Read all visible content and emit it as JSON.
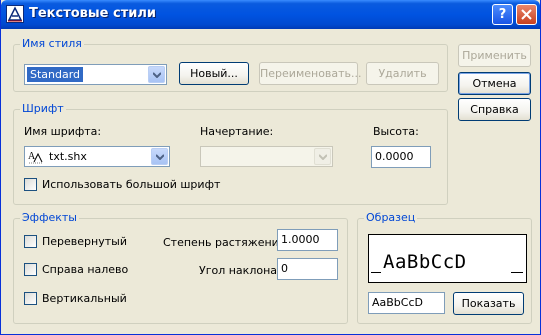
{
  "window": {
    "title": "Текстовые стили",
    "help_glyph": "?"
  },
  "style_group": {
    "legend": "Имя стиля",
    "style_combo_value": "Standard",
    "new_button": "Новый...",
    "rename_button": "Переименовать...",
    "delete_button": "Удалить"
  },
  "right_buttons": {
    "apply": "Применить",
    "cancel": "Отмена",
    "help": "Справка"
  },
  "font_group": {
    "legend": "Шрифт",
    "font_name_label": "Имя шрифта:",
    "font_name_value": "txt.shx",
    "style_label": "Начертание:",
    "height_label": "Высота:",
    "height_value": "0.0000",
    "big_font_label": "Использовать большой шрифт"
  },
  "effects_group": {
    "legend": "Эффекты",
    "upside_down": "Перевернутый",
    "backwards": "Справа налево",
    "vertical": "Вертикальный",
    "width_factor_label": "Степень растяжения:",
    "width_factor_value": "1.0000",
    "oblique_label": "Угол наклона:",
    "oblique_value": "0"
  },
  "preview_group": {
    "legend": "Образец",
    "preview_text": "AaBbCcD",
    "preview_input": "AaBbCcD",
    "show_button": "Показать"
  }
}
